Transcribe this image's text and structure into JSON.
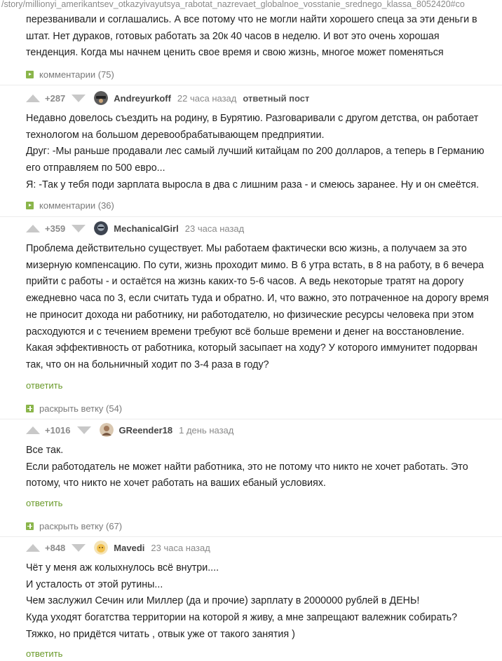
{
  "url": "/story/millionyi_amerikantsev_otkazyivayutsya_rabotat_nazrevaet_globalnoe_vosstanie_srednego_klassa_8052420#co",
  "top_text": {
    "lines": [
      "перезванивали и соглашались. А все потому что не могли найти хорошего спеца за эти деньги в",
      "штат. Нет дураков, готовых работать за 20к 40 часов в неделю. И вот это очень хорошая",
      "тенденция. Когда мы начнем ценить свое время и свою жизнь, многое может поменяться"
    ],
    "comments_link": "комментарии (75)"
  },
  "comments": [
    {
      "rating": "+287",
      "author": "Andreyurkoff",
      "time": "22 часа назад",
      "tag": "ответный пост",
      "lines": [
        "Недавно довелось съездить на родину, в Бурятию. Разговаривали с другом детства, он работает",
        "технологом на большом деревообрабатывающем предприятии.",
        "Друг: -Мы раньше продавали лес самый лучший китайцам по 200 долларов, а теперь в Германию",
        "его отправляем по 500 евро...",
        "Я: -Так у тебя поди зарплата выросла в два с лишним раза - и смеюсь заранее. Ну и он смеётся."
      ],
      "comments_link": "комментарии (36)"
    },
    {
      "rating": "+359",
      "author": "MechanicalGirl",
      "time": "23 часа назад",
      "lines": [
        "Проблема действительно существует. Мы работаем фактически всю жизнь, а получаем за это",
        "мизерную компенсацию. По сути, жизнь проходит мимо. В 6 утра встать, в 8 на работу, в 6 вечера",
        "прийти с работы - и остаётся на жизнь каких-то 5-6 часов. А ведь некоторые тратят на дорогу",
        "ежедневно часа по 3, если считать туда и обратно. И, что важно, это потраченное на дорогу время",
        "не приносит дохода ни работнику, ни работодателю, но физические ресурсы человека при этом",
        "расходуются и с течением времени требуют всё больше времени и денег на восстановление.",
        "Какая эффективность от работника, который засыпает на ходу? У которого иммунитет подорван",
        "так, что он на больничный ходит по 3-4 раза в году?"
      ],
      "reply": "ответить",
      "expand": "раскрыть ветку (54)"
    },
    {
      "rating": "+1016",
      "author": "GReender18",
      "time": "1 день назад",
      "lines": [
        "Все так.",
        "Если работодатель не может найти работника, это не потому что никто не хочет работать. Это",
        "потому, что никто не хочет работать на ваших ебаный условиях."
      ],
      "reply": "ответить",
      "expand": "раскрыть ветку (67)"
    },
    {
      "rating": "+848",
      "author": "Mavedi",
      "time": "23 часа назад",
      "lines": [
        "Чёт у меня аж колыхнулось всё внутри....",
        "И усталость от этой рутины...",
        "Чем заслужил Сечин или Миллер (да и прочие) зарплату в 2000000 рублей в ДЕНЬ!",
        "Куда уходят богатства территории на которой я живу, а мне запрещают валежник собирать?",
        "Тяжко, но придётся читать , отвык уже от такого занятия )"
      ],
      "reply": "ответить"
    }
  ],
  "colors": {
    "accent": "#8ab54a",
    "link": "#6a9a2a",
    "arrow": "#c8c8c8"
  },
  "icons": {
    "upvote": "arrow-up-icon",
    "downvote": "arrow-down-icon"
  }
}
